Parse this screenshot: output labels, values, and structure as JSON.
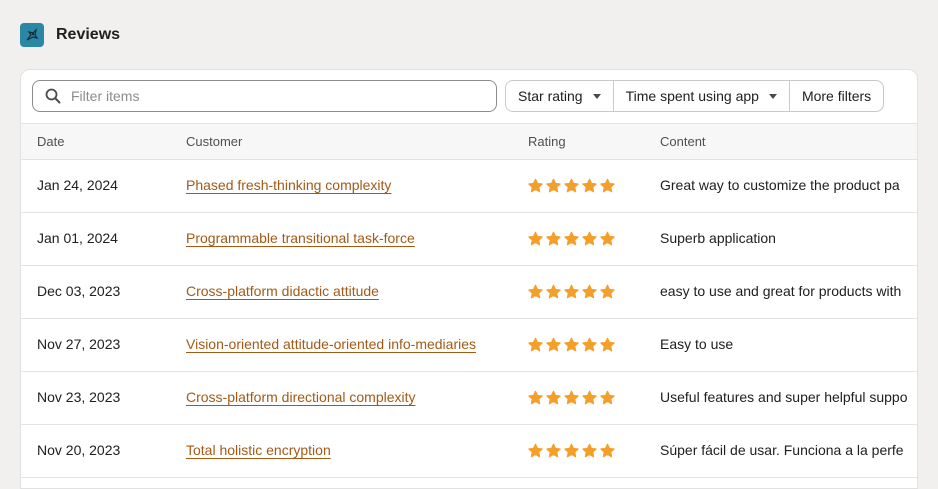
{
  "header": {
    "title": "Reviews",
    "logo_icon": "app-logo-icon"
  },
  "filters": {
    "search_placeholder": "Filter items",
    "buttons": [
      {
        "label": "Star rating",
        "has_caret": true
      },
      {
        "label": "Time spent using app",
        "has_caret": true
      },
      {
        "label": "More filters",
        "has_caret": false
      }
    ]
  },
  "table": {
    "columns": [
      "Date",
      "Customer",
      "Rating",
      "Content"
    ],
    "rows": [
      {
        "date": "Jan 24, 2024",
        "customer": "Phased fresh-thinking complexity",
        "rating": 5,
        "content": "Great way to customize the product pa"
      },
      {
        "date": "Jan 01, 2024",
        "customer": "Programmable transitional task-force",
        "rating": 5,
        "content": "Superb application"
      },
      {
        "date": "Dec 03, 2023",
        "customer": "Cross-platform didactic attitude",
        "rating": 5,
        "content": "easy to use and great for products with"
      },
      {
        "date": "Nov 27, 2023",
        "customer": "Vision-oriented attitude-oriented info-mediaries",
        "rating": 5,
        "content": "Easy to use"
      },
      {
        "date": "Nov 23, 2023",
        "customer": "Cross-platform directional complexity",
        "rating": 5,
        "content": "Useful features and super helpful suppo"
      },
      {
        "date": "Nov 20, 2023",
        "customer": "Total holistic encryption",
        "rating": 5,
        "content": "Súper fácil de usar. Funciona a la perfe"
      }
    ]
  },
  "colors": {
    "star": "#f49f2a",
    "link": "#a35a16",
    "logo_bg": "#2a87a5"
  }
}
